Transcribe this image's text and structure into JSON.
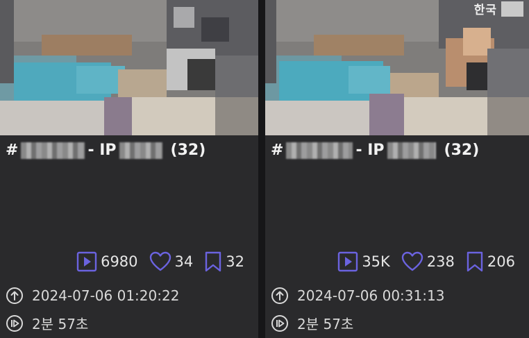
{
  "cards": [
    {
      "title_prefix": "#",
      "title_sep": "- IP",
      "title_count": "(32)",
      "badge": "",
      "stats": {
        "plays": "6980",
        "likes": "34",
        "saves": "32"
      },
      "uploaded": "2024-07-06 01:20:22",
      "duration": "2분 57초"
    },
    {
      "title_prefix": "#",
      "title_sep": "- IP",
      "title_count": "(32)",
      "badge": "한국",
      "stats": {
        "plays": "35K",
        "likes": "238",
        "saves": "206"
      },
      "uploaded": "2024-07-06 00:31:13",
      "duration": "2분 57초"
    }
  ],
  "colors": {
    "accent_icon": "#6b63e0",
    "card_bg": "#2a2a2c",
    "page_bg": "#1f1f21"
  },
  "icons": [
    "play-icon",
    "heart-icon",
    "bookmark-icon",
    "upload-icon",
    "duration-icon"
  ]
}
